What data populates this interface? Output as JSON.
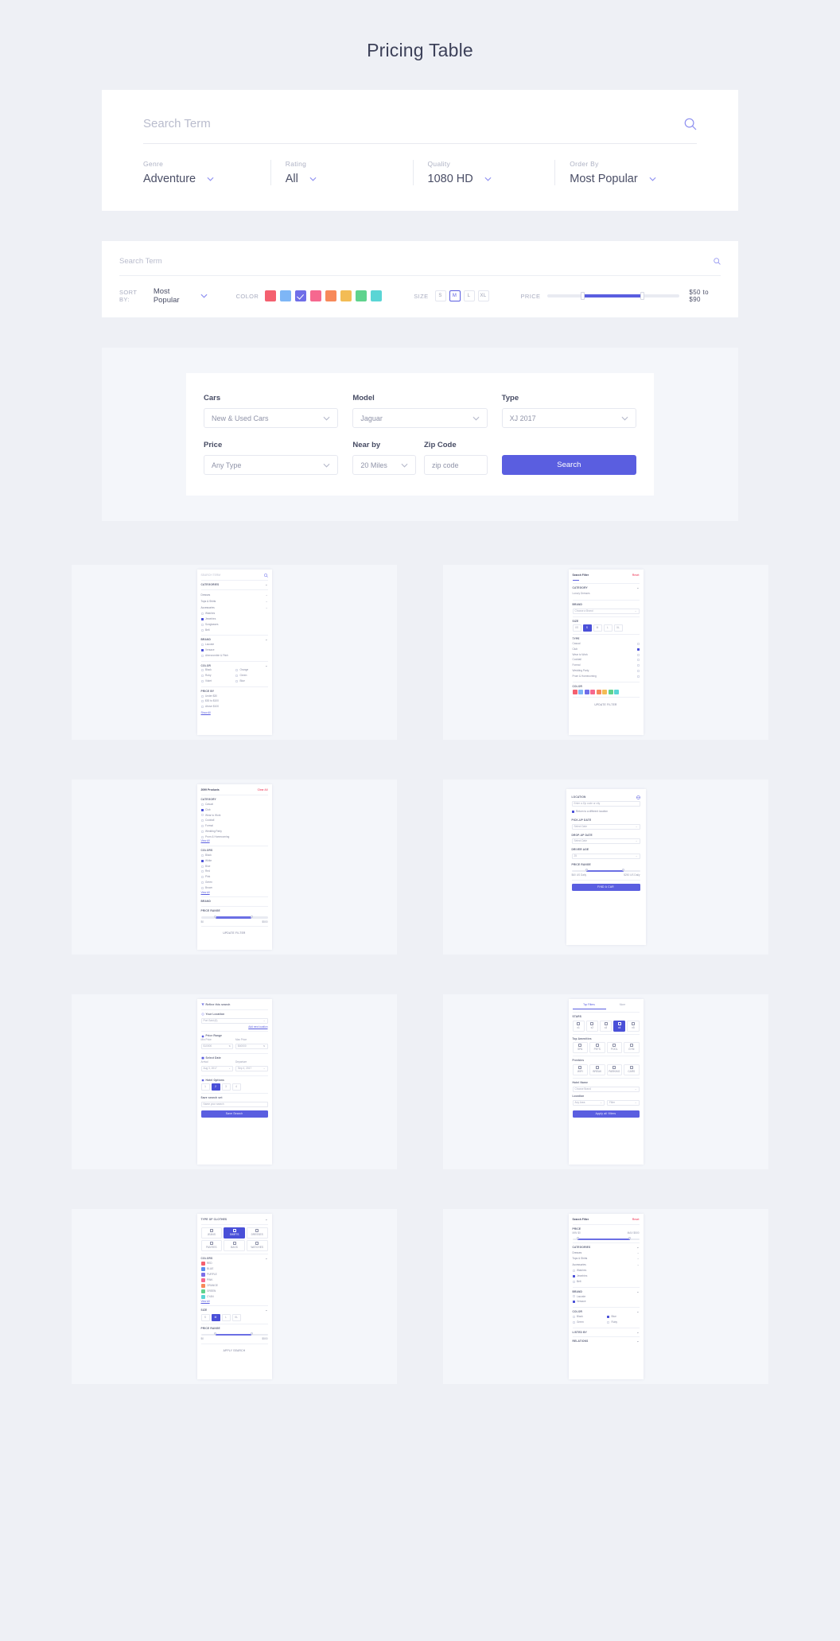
{
  "page": {
    "title": "Pricing Table",
    "bg": "#eef0f5"
  },
  "accent": "#5a5ee0",
  "danger": "#f2617a",
  "panel1": {
    "search_placeholder": "Search Term",
    "search_value": "",
    "fields": [
      {
        "label": "Genre",
        "value": "Adventure"
      },
      {
        "label": "Rating",
        "value": "All"
      },
      {
        "label": "Quality",
        "value": "1080 HD"
      },
      {
        "label": "Order By",
        "value": "Most Popular"
      }
    ]
  },
  "panel2": {
    "search_placeholder": "Search Term",
    "sort_label": "SORT BY:",
    "sort_value": "Most Popular",
    "color_label": "COLOR",
    "colors": [
      "#f4606f",
      "#7eb6f6",
      "#6f6ee8",
      "#f6688f",
      "#f7895a",
      "#f3bc55",
      "#5fd38d",
      "#5ad5d5"
    ],
    "color_selected_index": 2,
    "size_label": "SIZE",
    "sizes": [
      "S",
      "M",
      "L",
      "XL"
    ],
    "size_selected": "M",
    "price_label": "PRICE",
    "price_value": "$50 to $90"
  },
  "panel3": {
    "fields_row1": [
      {
        "label": "Cars",
        "value": "New & Used Cars"
      },
      {
        "label": "Model",
        "value": "Jaguar"
      },
      {
        "label": "Type",
        "value": "XJ 2017"
      }
    ],
    "fields_row2": [
      {
        "label": "Price",
        "value": "Any Type"
      },
      {
        "label": "Near by",
        "value": "20 Miles"
      },
      {
        "label": "Zip Code",
        "value": "zip code"
      }
    ],
    "search_button": "Search"
  },
  "mock1": {
    "search_placeholder": "SEARCH TERM",
    "section_categories": "CATEGORIES",
    "categories": [
      "Dresses",
      "Tops & Shirts",
      "Accessories"
    ],
    "accessory_options": [
      {
        "label": "Watches",
        "checked": false
      },
      {
        "label": "Jewelries",
        "checked": true
      },
      {
        "label": "Sunglasses",
        "checked": false
      },
      {
        "label": "Belt",
        "checked": false
      }
    ],
    "section_brand": "BRAND",
    "brands": [
      {
        "label": "Lacoste",
        "checked": false
      },
      {
        "label": "Versace",
        "checked": true
      },
      {
        "label": "Abercrombie & Fitch",
        "checked": false
      }
    ],
    "section_color": "COLOR",
    "colors": [
      {
        "label": "Black",
        "checked": false
      },
      {
        "label": "Orange",
        "checked": false
      },
      {
        "label": "Ruby",
        "checked": false
      },
      {
        "label": "Green",
        "checked": false
      },
      {
        "label": "Violet",
        "checked": false
      },
      {
        "label": "Blue",
        "checked": false
      }
    ],
    "section_price": "PRICE BY",
    "prices": [
      {
        "label": "Under $30",
        "checked": false
      },
      {
        "label": "$30 to $100",
        "checked": false
      },
      {
        "label": "Above $100",
        "checked": false
      }
    ],
    "footer_link": "Show All"
  },
  "mock2": {
    "title": "Search Filter",
    "reset": "Reset",
    "section_category": "CATEGORY",
    "category_value": "Luxury Dresses",
    "section_brand": "BRAND",
    "brand_value": "Choose a Brand",
    "section_size": "SIZE",
    "sizes": [
      "XS",
      "S",
      "M",
      "L",
      "XL"
    ],
    "size_selected": "S",
    "section_type": "TYPE",
    "types": [
      {
        "label": "Casual",
        "checked": false
      },
      {
        "label": "Club",
        "checked": true
      },
      {
        "label": "Wear to Work",
        "checked": false
      },
      {
        "label": "Cocktail",
        "checked": false
      },
      {
        "label": "Formal",
        "checked": false
      },
      {
        "label": "Wedding Party",
        "checked": false
      },
      {
        "label": "Prom & Homecoming",
        "checked": false
      }
    ],
    "section_color": "COLOR",
    "colors": [
      "#f4606f",
      "#7eb6f6",
      "#6f6ee8",
      "#f6688f",
      "#f7895a",
      "#f3bc55",
      "#5fd38d",
      "#5ad5d5"
    ],
    "color_selected_index": 2,
    "button": "UPDATE FILTER"
  },
  "mock3": {
    "title": "2099 Products",
    "clear": "Clear All",
    "section_category": "CATEGORY",
    "categories": [
      {
        "label": "Casual",
        "checked": false
      },
      {
        "label": "Club",
        "checked": true
      },
      {
        "label": "Wear to Work",
        "checked": false
      },
      {
        "label": "Cocktail",
        "checked": false
      },
      {
        "label": "Formal",
        "checked": false
      },
      {
        "label": "Wedding Party",
        "checked": false
      },
      {
        "label": "Prom & Homecoming",
        "checked": false
      }
    ],
    "view_all": "View All",
    "section_colors": "COLORS",
    "colors": [
      {
        "label": "Black",
        "checked": false
      },
      {
        "label": "White",
        "checked": true
      },
      {
        "label": "Blue",
        "checked": false
      },
      {
        "label": "Red",
        "checked": false
      },
      {
        "label": "Pink",
        "checked": false
      },
      {
        "label": "Green",
        "checked": false
      },
      {
        "label": "Brown",
        "checked": false
      }
    ],
    "colors_view_all": "View All",
    "section_brand": "BRAND",
    "section_price": "PRICE RANGE",
    "price_min": "$0",
    "price_max": "$500",
    "button": "UPDATE FILTER"
  },
  "mock4": {
    "title": "LOCATION",
    "location_placeholder": "Enter a Zip code or city",
    "return_option": "Return to a different location",
    "return_checked": true,
    "pickup_label": "PICK-UP DATE",
    "pickup_value": "Select Date",
    "dropup_label": "DROP-UP DATE",
    "dropup_value": "Select Date",
    "driver_label": "DRIVER AGE",
    "driver_value": "25",
    "price_label": "PRICE RANGE",
    "price_min": "$60 US Daily",
    "price_max": "$250 US Daily",
    "button": "FIND A CAR"
  },
  "mock5": {
    "title": "Refine this search",
    "location_label": "Your Location",
    "location_value": "Port Said (6)",
    "add_location": "Add new location",
    "price_label": "Price Range",
    "min_label": "Min Price",
    "min_value": "$10000",
    "max_label": "Max Price",
    "max_value": "$40000",
    "date_label": "Select Date",
    "arrival_label": "Arrival",
    "arrival_value": "Aug 3, 2017",
    "departure_label": "Departure",
    "departure_value": "Sep 4, 2017",
    "options_label": "Hotel Options",
    "options": [
      "1",
      "2",
      "3",
      "4"
    ],
    "option_selected_index": 1,
    "save_label": "Save search set",
    "save_placeholder": "Name your search",
    "button": "Save Search"
  },
  "mock6": {
    "tabs": [
      "Top Filters",
      "More"
    ],
    "tab_active": "Top Filters",
    "stars_label": "STARS",
    "stars": [
      "x1",
      "x2",
      "x3",
      "x4",
      "x5"
    ],
    "star_selected": "x4",
    "amenities_label": "Top Amenities",
    "amenities": [
      "SPA",
      "PETS",
      "POOL",
      "GYM"
    ],
    "freebies_label": "Freebies",
    "freebies": [
      "WIFI",
      "BREAK",
      "PARKING",
      "CARS"
    ],
    "hotel_label": "Hotel Name",
    "hotel_value": "Choose Brand",
    "location_label": "Location",
    "loc_value_a": "Any Area",
    "loc_value_b": "Filter",
    "button": "Apply all filters"
  },
  "mock7": {
    "title": "TYPE OF CLOTHES",
    "tiles_row1": [
      "JEANS",
      "SHIRTS",
      "DRESSES"
    ],
    "tiles_row2": [
      "PANTIES",
      "BAGS",
      "WATCHES"
    ],
    "tile_selected": "SHIRTS",
    "colors_label": "COLORS",
    "colors": [
      {
        "label": "RED",
        "hex": "#f4606f"
      },
      {
        "label": "BLUE",
        "hex": "#5b8def"
      },
      {
        "label": "PURPLE",
        "hex": "#7e6ee8"
      },
      {
        "label": "PINK",
        "hex": "#f6688f"
      },
      {
        "label": "ORANGE",
        "hex": "#f7895a"
      },
      {
        "label": "GREEN",
        "hex": "#5fd38d"
      },
      {
        "label": "CYAN",
        "hex": "#5ad5d5"
      }
    ],
    "view_all": "View All",
    "size_label": "SIZE",
    "sizes": [
      "S",
      "M",
      "L",
      "XL"
    ],
    "size_selected": "M",
    "price_label": "PRICE RANGE",
    "price_min": "$0",
    "price_max": "$500",
    "button": "APPLY SEARCH"
  },
  "mock8": {
    "title": "Search Filter",
    "reset": "Reset",
    "price_label": "PRICE",
    "price_min_label": "MIN $0",
    "price_max_label": "MAX $500",
    "categories_label": "CATEGORIES",
    "categories": [
      "Dresses",
      "Tops & Shirts",
      "Accessories"
    ],
    "accessories": [
      {
        "label": "Watches",
        "checked": false
      },
      {
        "label": "Jewelries",
        "checked": true
      },
      {
        "label": "Belt",
        "checked": false
      }
    ],
    "brand_label": "BRAND",
    "brands": [
      {
        "label": "Lacoste",
        "checked": false
      },
      {
        "label": "Versace",
        "checked": true
      }
    ],
    "color_label": "COLOR",
    "colors": [
      {
        "label": "Black",
        "checked": false
      },
      {
        "label": "Blue",
        "checked": true
      },
      {
        "label": "Green",
        "checked": false
      },
      {
        "label": "Ruby",
        "checked": false
      }
    ],
    "listed_label": "LISTED BY",
    "relations_label": "RELATIONS"
  }
}
